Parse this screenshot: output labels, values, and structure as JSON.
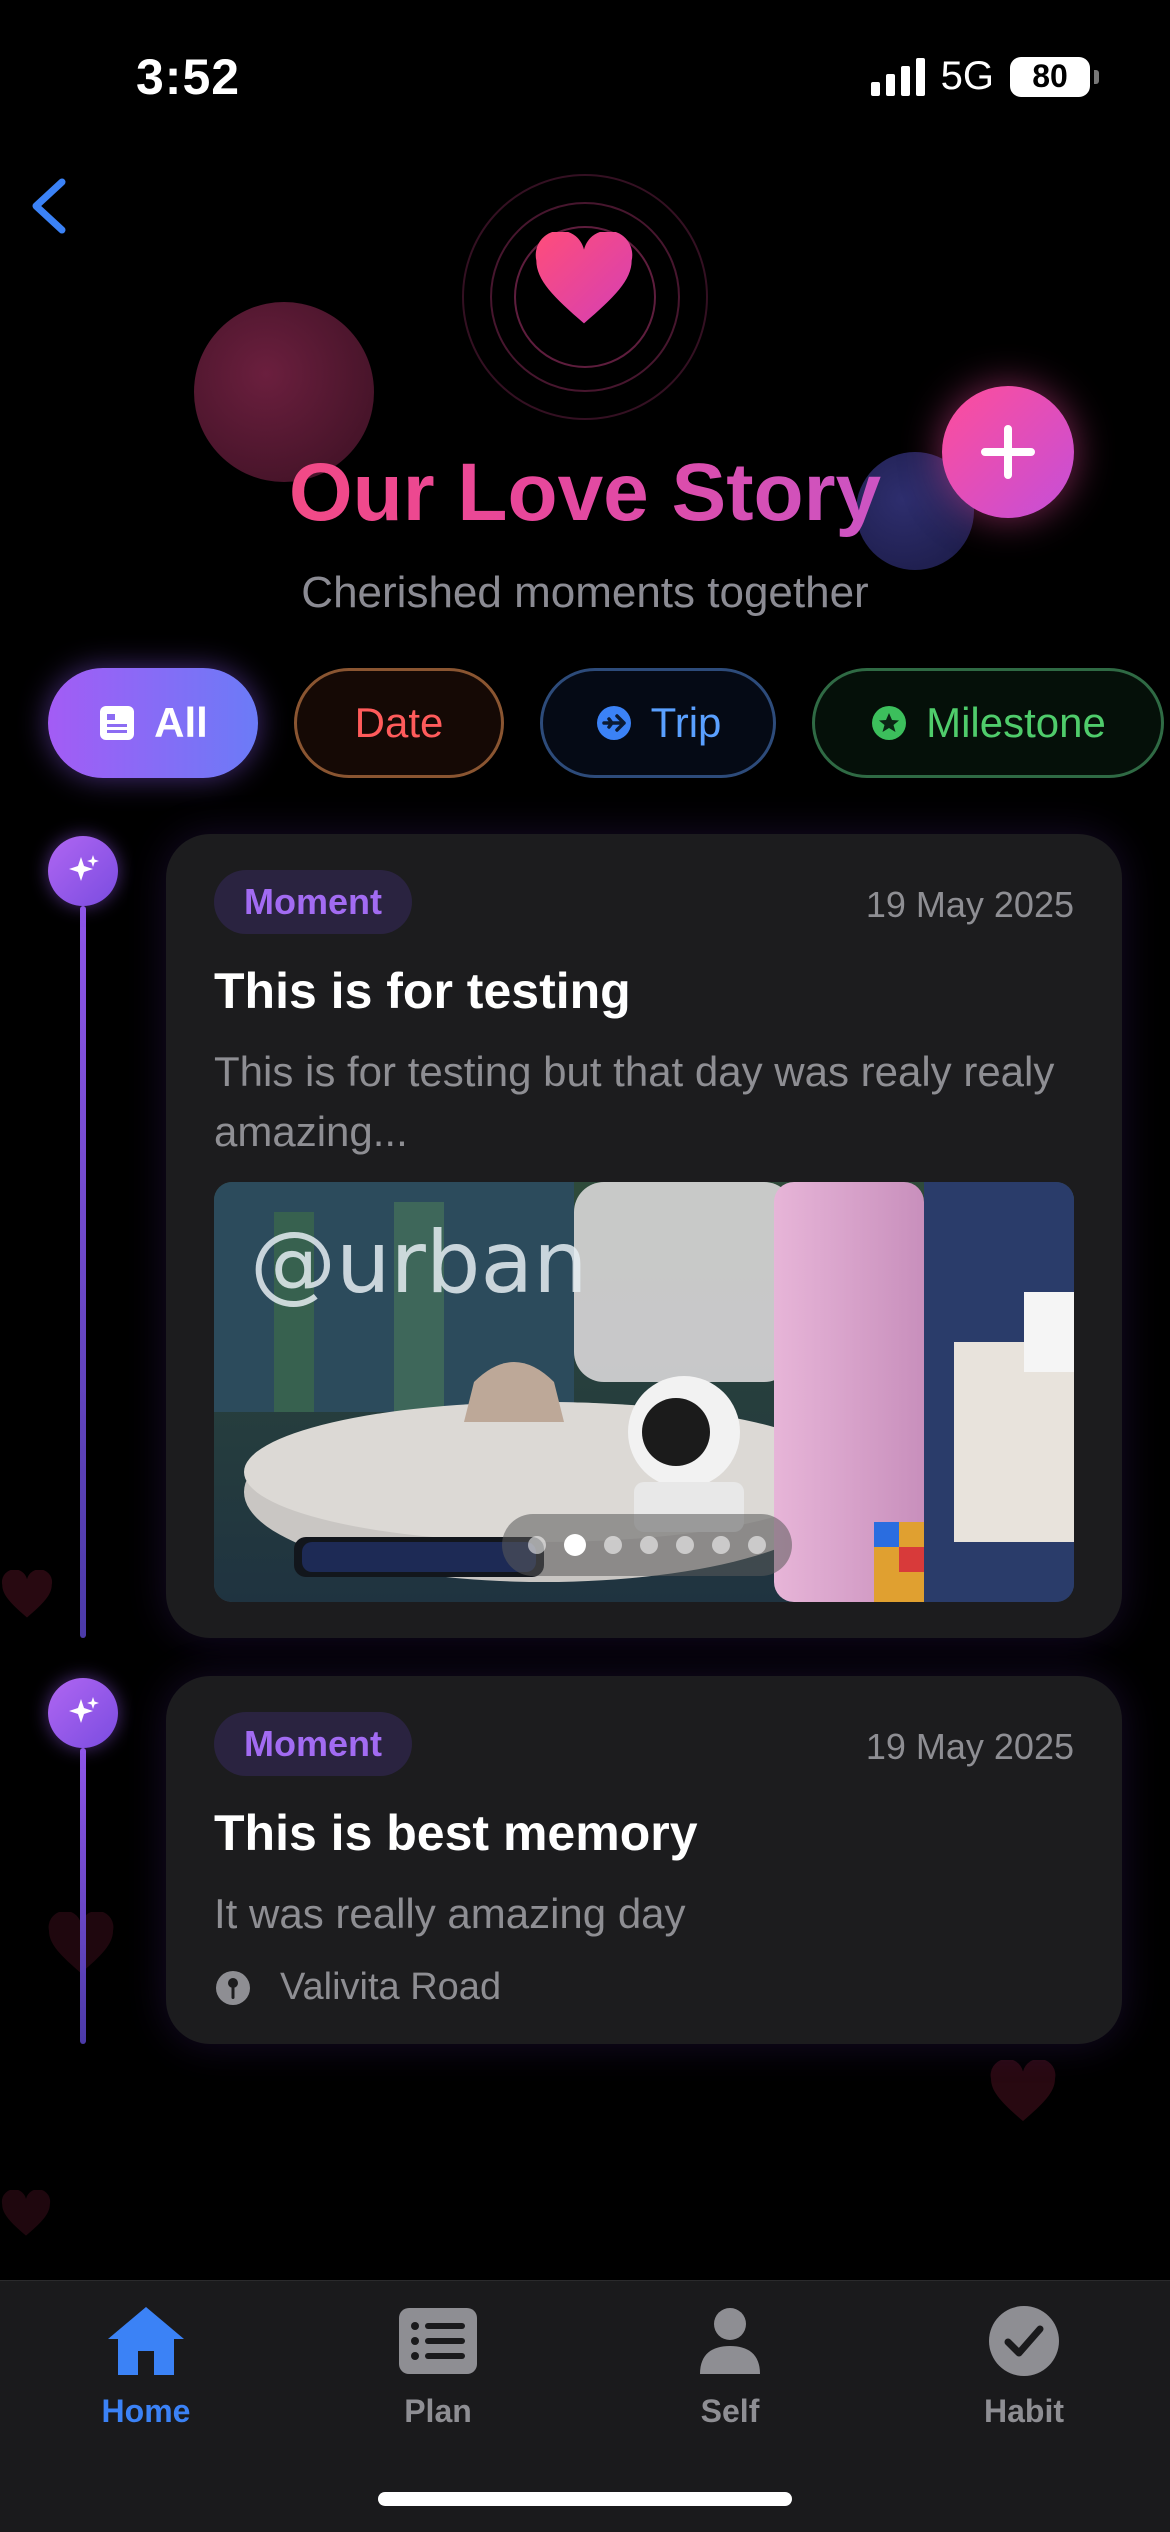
{
  "status": {
    "time": "3:52",
    "network": "5G",
    "battery": "80"
  },
  "header": {
    "title": "Our Love Story",
    "subtitle": "Cherished moments together",
    "add_icon": "plus-icon",
    "back_icon": "chevron-left-icon"
  },
  "filters": [
    {
      "label": "All",
      "icon": "list-icon",
      "color": "#a35cf5",
      "selected": true
    },
    {
      "label": "Date",
      "icon": "",
      "color": "#ff5b5b",
      "selected": false
    },
    {
      "label": "Trip",
      "icon": "airplane-icon",
      "color": "#5aa0ff",
      "selected": false
    },
    {
      "label": "Milestone",
      "icon": "star-icon",
      "color": "#4fcc6b",
      "selected": false
    }
  ],
  "moments": [
    {
      "badge": "Moment",
      "date": "19 May 2025",
      "title": "This is for testing",
      "description": "This is for testing but that day was realy realy amazing...",
      "has_photo": true,
      "photo_count": 7,
      "photo_index": 1
    },
    {
      "badge": "Moment",
      "date": "19 May 2025",
      "title": "This is best memory",
      "description": "It was really amazing day",
      "location": "Valivita Road",
      "has_photo": false
    }
  ],
  "tabs": [
    {
      "label": "Home",
      "icon": "home-icon",
      "active": true
    },
    {
      "label": "Plan",
      "icon": "list-icon",
      "active": false
    },
    {
      "label": "Self",
      "icon": "person-icon",
      "active": false
    },
    {
      "label": "Habit",
      "icon": "checkmark-icon",
      "active": false
    }
  ],
  "colors": {
    "accent": "#3b82f6",
    "brand_pink": "#e8479a",
    "brand_purple": "#a35cf5",
    "card": "#1c1c1e"
  }
}
